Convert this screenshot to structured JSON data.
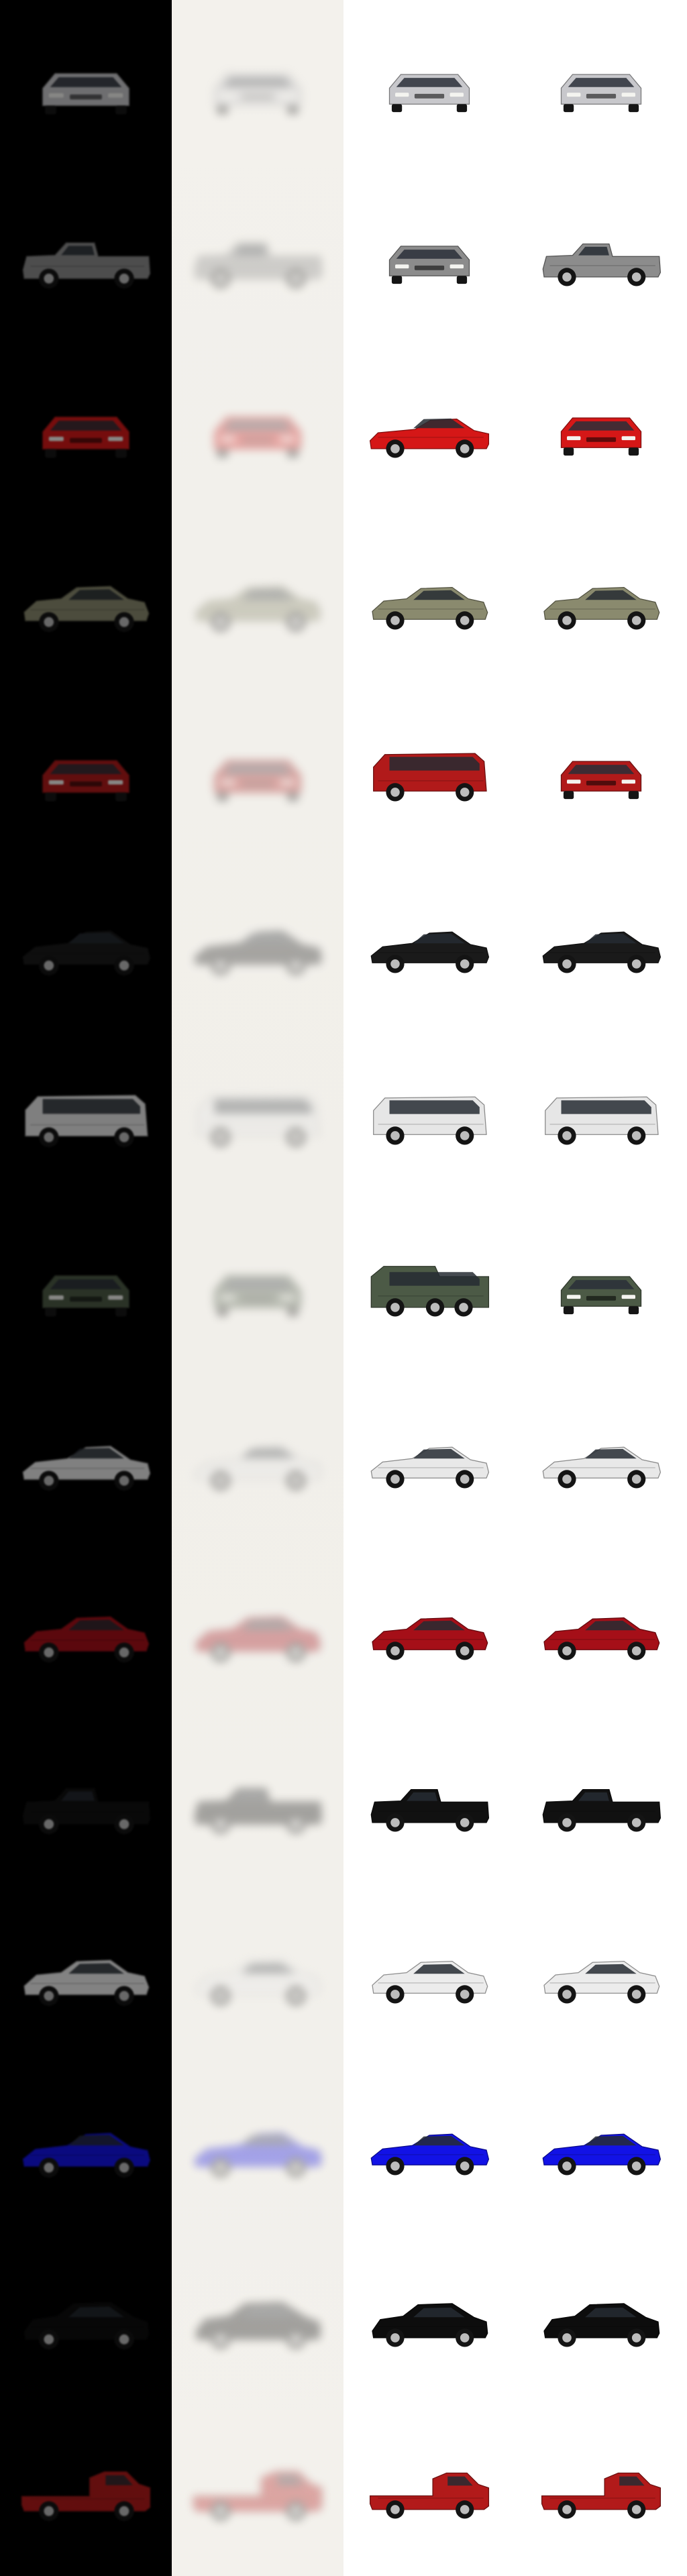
{
  "grid": {
    "columns": [
      {
        "name": "dark-render",
        "background": "#000000"
      },
      {
        "name": "blurred-render",
        "background": "#f2f0eb"
      },
      {
        "name": "reference-view-a",
        "background": "#ffffff"
      },
      {
        "name": "reference-view-b",
        "background": "#ffffff"
      }
    ],
    "rows": [
      {
        "vehicle": "silver-sedan-front",
        "color": "#c8c8cc"
      },
      {
        "vehicle": "silver-offroad-pickup",
        "color": "#8c8c8c"
      },
      {
        "vehicle": "red-race-car",
        "color": "#d51717"
      },
      {
        "vehicle": "olive-police-car",
        "color": "#8a8a6e"
      },
      {
        "vehicle": "red-minivan",
        "color": "#b11a1a"
      },
      {
        "vehicle": "black-muscle-car",
        "color": "#1a1a1a"
      },
      {
        "vehicle": "white-cargo-van",
        "color": "#e6e6e6"
      },
      {
        "vehicle": "green-armored-truck",
        "color": "#4c5a46"
      },
      {
        "vehicle": "white-sports-coupe",
        "color": "#e8e8e8"
      },
      {
        "vehicle": "red-sedan",
        "color": "#a50f18"
      },
      {
        "vehicle": "black-pickup",
        "color": "#111111"
      },
      {
        "vehicle": "white-police-cruiser",
        "color": "#ececec"
      },
      {
        "vehicle": "blue-sports-coupe",
        "color": "#1212e6"
      },
      {
        "vehicle": "black-hatchback",
        "color": "#0d0d0d"
      },
      {
        "vehicle": "red-flatbed-truck",
        "color": "#b21a1a"
      }
    ]
  }
}
